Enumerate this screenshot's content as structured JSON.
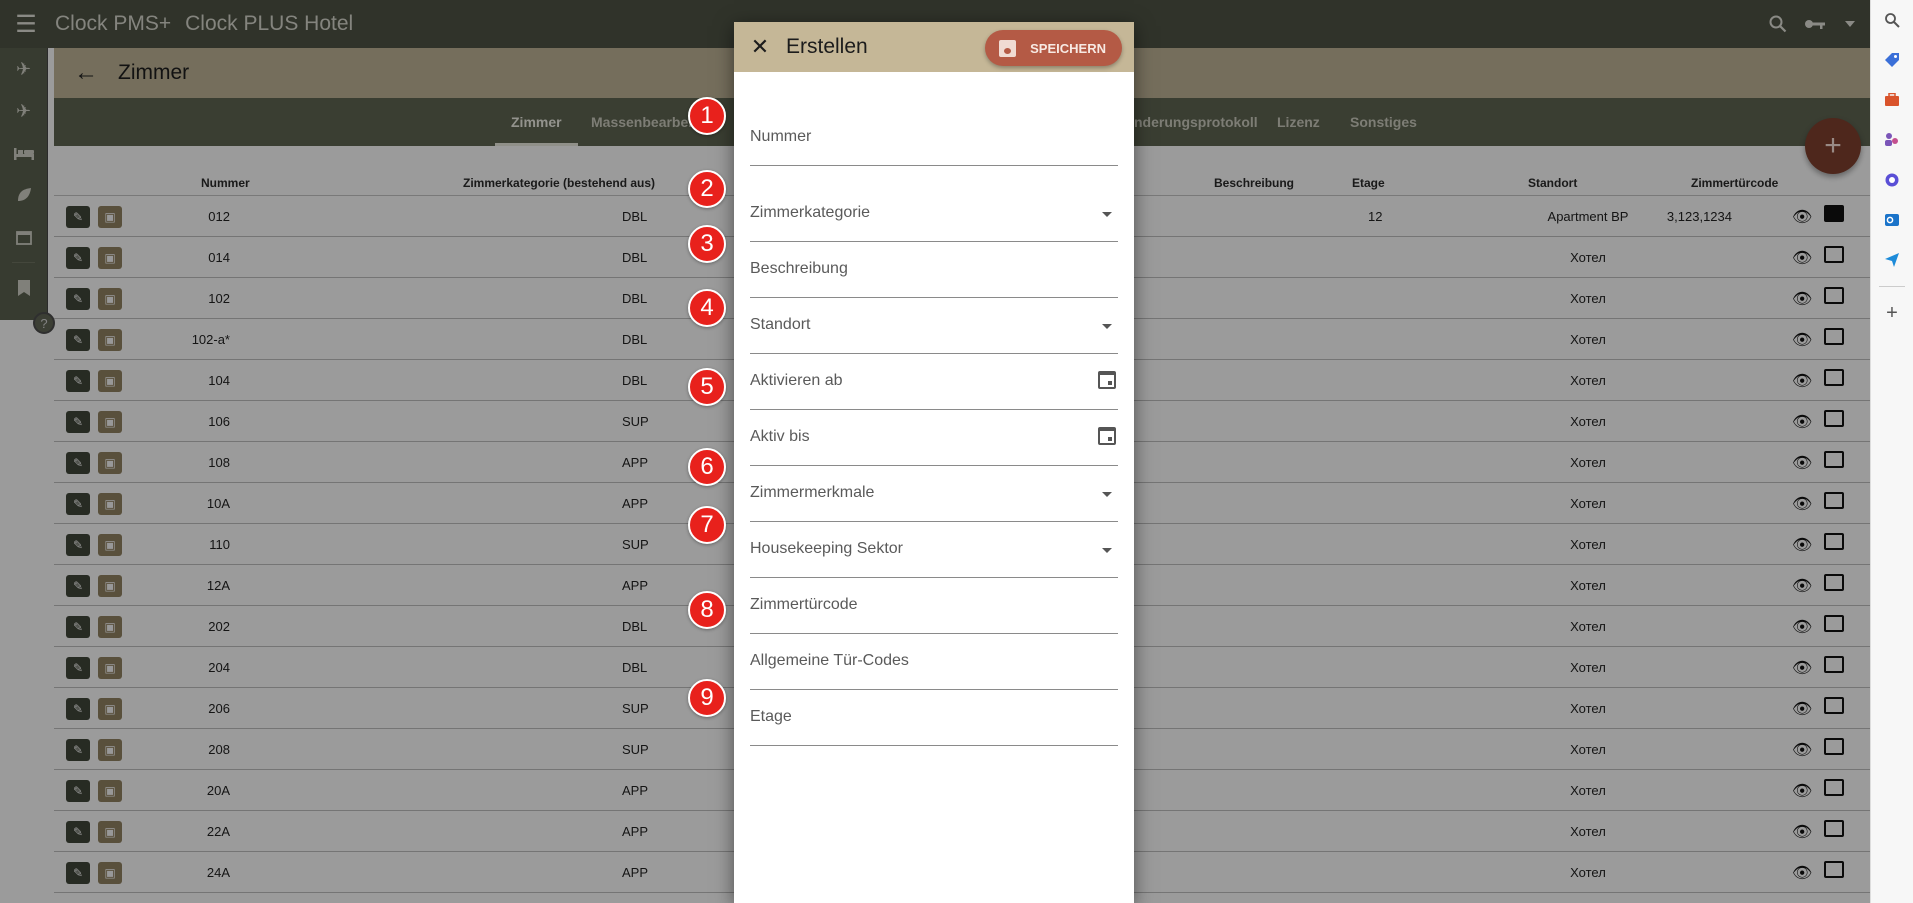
{
  "app": {
    "title": "Clock PMS+",
    "hotel": "Clock PLUS Hotel"
  },
  "header": {
    "title": "Zimmer"
  },
  "tabs": [
    {
      "label": "Zimmer"
    },
    {
      "label": "Massenbearbei"
    },
    {
      "label": "nderungsprotokoll"
    },
    {
      "label": "Lizenz"
    },
    {
      "label": "Sonstiges"
    }
  ],
  "table": {
    "headers": {
      "number": "Nummer",
      "category": "Zimmerkategorie (bestehend aus)",
      "description": "Beschreibung",
      "floor": "Etage",
      "location": "Standort",
      "code": "Zimmertürcode"
    },
    "rows": [
      {
        "number": "012",
        "category": "DBL",
        "floor": "12",
        "location": "Apartment BP",
        "code": "3,123,1234"
      },
      {
        "number": "014",
        "category": "DBL",
        "floor": "",
        "location": "Хотел",
        "code": ""
      },
      {
        "number": "102",
        "category": "DBL",
        "floor": "",
        "location": "Хотел",
        "code": ""
      },
      {
        "number": "102-a*",
        "category": "DBL",
        "floor": "",
        "location": "Хотел",
        "code": ""
      },
      {
        "number": "104",
        "category": "DBL",
        "floor": "",
        "location": "Хотел",
        "code": ""
      },
      {
        "number": "106",
        "category": "SUP",
        "floor": "",
        "location": "Хотел",
        "code": ""
      },
      {
        "number": "108",
        "category": "APP",
        "floor": "",
        "location": "Хотел",
        "code": ""
      },
      {
        "number": "10A",
        "category": "APP",
        "floor": "",
        "location": "Хотел",
        "code": ""
      },
      {
        "number": "110",
        "category": "SUP",
        "floor": "",
        "location": "Хотел",
        "code": ""
      },
      {
        "number": "12A",
        "category": "APP",
        "floor": "",
        "location": "Хотел",
        "code": ""
      },
      {
        "number": "202",
        "category": "DBL",
        "floor": "",
        "location": "Хотел",
        "code": ""
      },
      {
        "number": "204",
        "category": "DBL",
        "floor": "",
        "location": "Хотел",
        "code": ""
      },
      {
        "number": "206",
        "category": "SUP",
        "floor": "",
        "location": "Хотел",
        "code": ""
      },
      {
        "number": "208",
        "category": "SUP",
        "floor": "",
        "location": "Хотел",
        "code": ""
      },
      {
        "number": "20A",
        "category": "APP",
        "floor": "",
        "location": "Хотел",
        "code": ""
      },
      {
        "number": "22A",
        "category": "APP",
        "floor": "",
        "location": "Хотел",
        "code": ""
      },
      {
        "number": "24A",
        "category": "APP",
        "floor": "",
        "location": "Хотел",
        "code": ""
      }
    ]
  },
  "dialog": {
    "title": "Erstellen",
    "save_label": "SPEICHERN",
    "fields": [
      {
        "label": "Nummer",
        "kind": "text"
      },
      {
        "label": "Zimmerkategorie",
        "kind": "select"
      },
      {
        "label": "Beschreibung",
        "kind": "text"
      },
      {
        "label": "Standort",
        "kind": "select"
      },
      {
        "label": "Aktivieren ab",
        "kind": "date"
      },
      {
        "label": "Aktiv bis",
        "kind": "date"
      },
      {
        "label": "Zimmermerkmale",
        "kind": "select"
      },
      {
        "label": "Housekeeping Sektor",
        "kind": "select"
      },
      {
        "label": "Zimmertürcode",
        "kind": "text"
      },
      {
        "label": "Allgemeine Tür-Codes",
        "kind": "text"
      },
      {
        "label": "Etage",
        "kind": "text"
      }
    ]
  },
  "markers": [
    "1",
    "2",
    "3",
    "4",
    "5",
    "6",
    "7",
    "8",
    "9"
  ],
  "fab_label": "+",
  "help_label": "?",
  "colors": {
    "topbar": "#4b5142",
    "header": "#b7ad91",
    "tabs": "#5b614f",
    "dialog_header": "#c5b797",
    "save_button": "#b45a45",
    "fab": "#7a3d2c",
    "marker": "#e8211c"
  },
  "icons": {
    "top": [
      "menu-icon",
      "search-icon",
      "key-icon",
      "caret-down-icon"
    ],
    "rail": [
      "plane-arrival-icon",
      "plane-departure-icon",
      "bed-icon",
      "leaf-icon",
      "calendar-icon",
      "book-icon"
    ],
    "browser_sidebar": [
      "search-icon",
      "tag-icon",
      "briefcase-icon",
      "people-icon",
      "copilot-icon",
      "outlook-icon",
      "send-icon",
      "add-icon"
    ]
  }
}
